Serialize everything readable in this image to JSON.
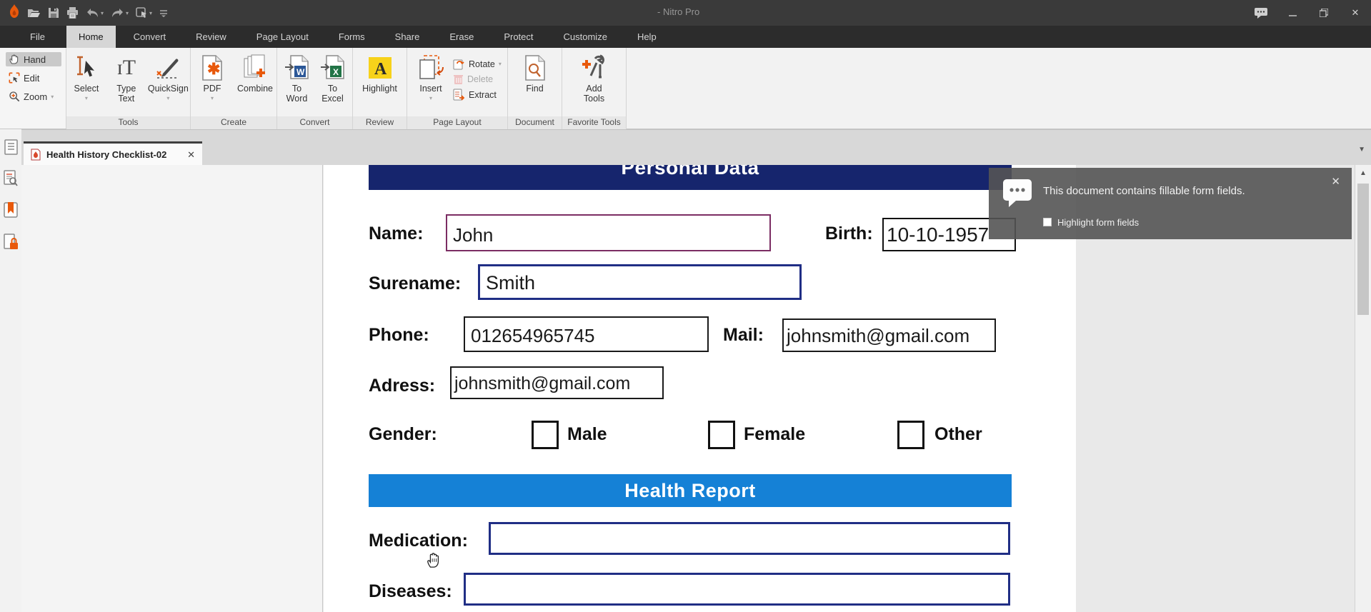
{
  "titlebar": {
    "title": "- Nitro Pro"
  },
  "menu": {
    "tabs": [
      {
        "label": "File",
        "active": false
      },
      {
        "label": "Home",
        "active": true
      },
      {
        "label": "Convert",
        "active": false
      },
      {
        "label": "Review",
        "active": false
      },
      {
        "label": "Page Layout",
        "active": false
      },
      {
        "label": "Forms",
        "active": false
      },
      {
        "label": "Share",
        "active": false
      },
      {
        "label": "Erase",
        "active": false
      },
      {
        "label": "Protect",
        "active": false
      },
      {
        "label": "Customize",
        "active": false
      },
      {
        "label": "Help",
        "active": false
      }
    ]
  },
  "ribbon": {
    "tool_stack": [
      {
        "label": "Hand",
        "selected": true
      },
      {
        "label": "Edit",
        "selected": false
      },
      {
        "label": "Zoom",
        "selected": false,
        "dropdown": "▾"
      }
    ],
    "groups": [
      {
        "label": "Tools",
        "buttons": [
          {
            "line1": "Select",
            "line2": "▾"
          },
          {
            "line1": "Type",
            "line2": "Text"
          },
          {
            "line1": "QuickSign",
            "line2": "▾"
          }
        ]
      },
      {
        "label": "Create",
        "buttons": [
          {
            "line1": "PDF",
            "line2": "▾"
          },
          {
            "line1": "Combine",
            "line2": ""
          }
        ]
      },
      {
        "label": "Convert",
        "buttons": [
          {
            "line1": "To",
            "line2": "Word"
          },
          {
            "line1": "To",
            "line2": "Excel"
          }
        ]
      },
      {
        "label": "Review",
        "buttons": [
          {
            "line1": "Highlight",
            "line2": ""
          }
        ]
      },
      {
        "label": "Page Layout",
        "buttons": [
          {
            "line1": "Insert",
            "line2": "▾"
          }
        ],
        "small_buttons": [
          {
            "label": "Rotate",
            "dropdown": "▾",
            "disabled": false
          },
          {
            "label": "Delete",
            "dropdown": "",
            "disabled": true
          },
          {
            "label": "Extract",
            "dropdown": "",
            "disabled": false
          }
        ]
      },
      {
        "label": "Document",
        "buttons": [
          {
            "line1": "Find",
            "line2": ""
          }
        ]
      },
      {
        "label": "Favorite Tools",
        "buttons": [
          {
            "line1": "Add",
            "line2": "Tools"
          }
        ]
      }
    ]
  },
  "tabbar": {
    "document_title": "Health History Checklist-02",
    "close_glyph": "✕"
  },
  "sidebar": {
    "panels": [
      "page-thumbnails",
      "document-preview",
      "bookmarks",
      "security"
    ]
  },
  "form": {
    "section1_title": "Personal Data",
    "section2_title": "Health Report",
    "name": {
      "label": "Name:",
      "value": "John"
    },
    "birth": {
      "label": "Birth:",
      "value": "10-10-1957"
    },
    "surname": {
      "label": "Surename:",
      "value": "Smith"
    },
    "phone": {
      "label": "Phone:",
      "value": "012654965745"
    },
    "mail": {
      "label": "Mail:",
      "value": "johnsmith@gmail.com"
    },
    "address": {
      "label": "Adress:",
      "value": "johnsmith@gmail.com"
    },
    "gender": {
      "label": "Gender:",
      "options": [
        "Male",
        "Female",
        "Other"
      ],
      "checked": [
        false,
        false,
        false
      ]
    },
    "medication": {
      "label": "Medication:",
      "value": ""
    },
    "diseases": {
      "label": "Diseases:",
      "value": ""
    }
  },
  "notification": {
    "message": "This document contains fillable form fields.",
    "checkbox_label": "Highlight form fields",
    "checked": false,
    "close_glyph": "✕"
  },
  "colors": {
    "header_navy": "#16256d",
    "header_blue": "#1581d6",
    "accent_orange": "#e8590c",
    "name_field_border": "#7b2d63",
    "active_field_border": "#202e85"
  }
}
